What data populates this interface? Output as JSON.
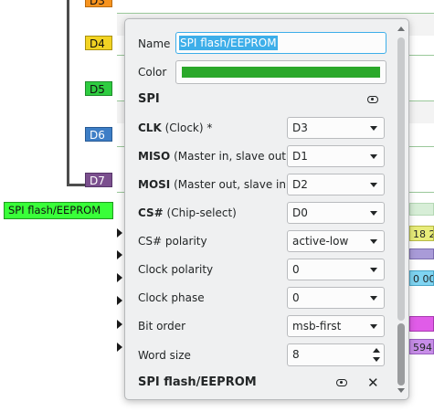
{
  "background": {
    "channels": [
      {
        "label": "D3",
        "color": "#f7931e"
      },
      {
        "label": "D4",
        "color": "#f2d323"
      },
      {
        "label": "D5",
        "color": "#2ecc40"
      },
      {
        "label": "D6",
        "color": "#3d7ec6"
      },
      {
        "label": "D7",
        "color": "#7b4f8e"
      }
    ],
    "decoder_tag": {
      "label": "SPI flash/EEPROM",
      "color": "#39ff39"
    },
    "chips": [
      {
        "text": "18 2",
        "color": "#e8ec7a"
      },
      {
        "text": "0 00",
        "color": "#7fd4f2"
      },
      {
        "text": "594,",
        "color": "#c78de8"
      }
    ]
  },
  "popup": {
    "name_label": "Name",
    "name_value": "SPI flash/EEPROM",
    "color_label": "Color",
    "color_value": "#2aa82a",
    "section_spi": "SPI",
    "fields": [
      {
        "bold": "CLK",
        "rest": " (Clock) *",
        "value": "D3"
      },
      {
        "bold": "MISO",
        "rest": " (Master in, slave out)",
        "value": "D1"
      },
      {
        "bold": "MOSI",
        "rest": " (Master out, slave in)",
        "value": "D2"
      },
      {
        "bold": "CS#",
        "rest": " (Chip-select)",
        "value": "D0"
      },
      {
        "bold": "",
        "rest": "CS# polarity",
        "value": "active-low"
      },
      {
        "bold": "",
        "rest": "Clock polarity",
        "value": "0"
      },
      {
        "bold": "",
        "rest": "Clock phase",
        "value": "0"
      },
      {
        "bold": "",
        "rest": "Bit order",
        "value": "msb-first"
      }
    ],
    "word_size_label": "Word size",
    "word_size_value": "8",
    "section_decoder": "SPI flash/EEPROM"
  }
}
